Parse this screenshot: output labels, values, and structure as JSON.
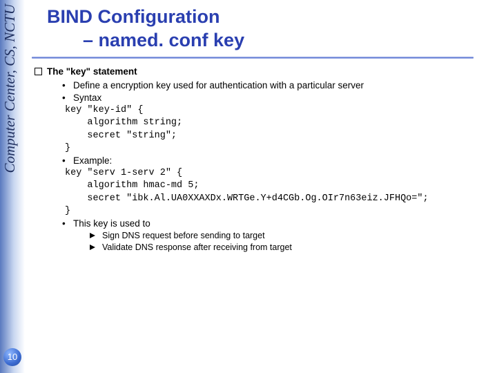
{
  "sidebar": {
    "label": "Computer Center, CS, NCTU"
  },
  "page_number": "10",
  "title": {
    "line1": "BIND Configuration",
    "line2": "– named. conf  key"
  },
  "section": {
    "heading": "The \"key\" statement"
  },
  "bullets": {
    "b1": "Define a encryption key used for authentication with a particular server",
    "b2": "Syntax",
    "b3": "Example:",
    "b4": "This key is used to"
  },
  "code": {
    "syntax_l1": "key \"key-id\" {",
    "syntax_l2": "    algorithm string;",
    "syntax_l3": "    secret \"string\";",
    "syntax_l4": "}",
    "ex_l1": "key \"serv 1-serv 2\" {",
    "ex_l2": "    algorithm hmac-md 5;",
    "ex_l3": "    secret \"ibk.Al.UA0XXAXDx.WRTGe.Y+d4CGb.Og.OIr7n63eiz.JFHQo=\";",
    "ex_l4": "}"
  },
  "sub": {
    "s1": "Sign DNS request before sending to target",
    "s2": "Validate DNS response after receiving from target"
  }
}
